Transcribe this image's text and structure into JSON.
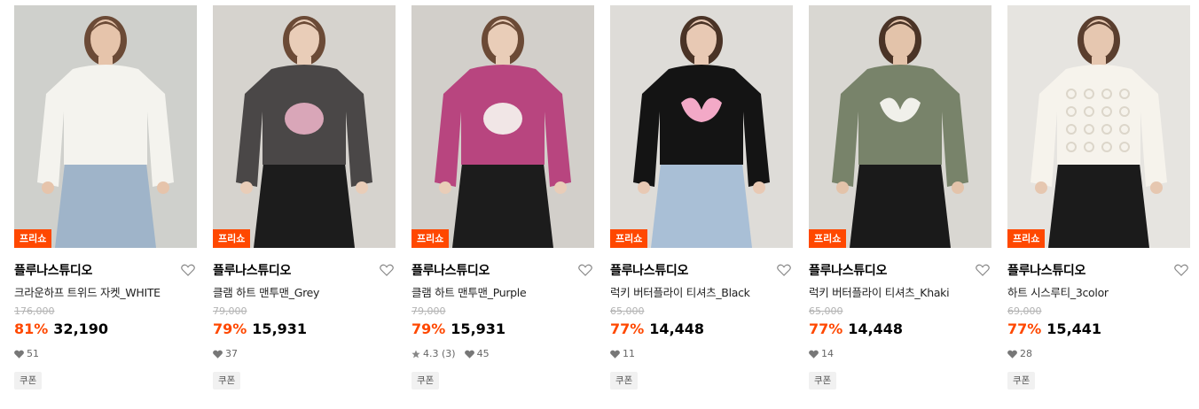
{
  "products": [
    {
      "tag": "프리쇼",
      "brand": "플루나스튜디오",
      "name": "크라운하프 트위드 자켓_WHITE",
      "original_price": "176,000",
      "discount": "81%",
      "price": "32,190",
      "rating": "",
      "likes": "51",
      "coupon": "쿠폰",
      "photo": {
        "bg": "#cfd0cc",
        "top": "#f4f3ee",
        "bottom": "#9fb4c9",
        "skin": "#e6c4ab",
        "hair": "#6b4a36",
        "accent": "#f4f3ee"
      }
    },
    {
      "tag": "프리쇼",
      "brand": "플루나스튜디오",
      "name": "클램 하트 맨투맨_Grey",
      "original_price": "79,000",
      "discount": "79%",
      "price": "15,931",
      "rating": "",
      "likes": "37",
      "coupon": "쿠폰",
      "photo": {
        "bg": "#d6d3ce",
        "top": "#4a4747",
        "bottom": "#1c1c1c",
        "skin": "#e9cdb8",
        "hair": "#6b4a36",
        "accent": "#d9a6b8"
      }
    },
    {
      "tag": "프리쇼",
      "brand": "플루나스튜디오",
      "name": "클램 하트 맨투맨_Purple",
      "original_price": "79,000",
      "discount": "79%",
      "price": "15,931",
      "rating": "4.3 (3)",
      "likes": "45",
      "coupon": "쿠폰",
      "photo": {
        "bg": "#d2cfca",
        "top": "#b8457f",
        "bottom": "#1c1c1c",
        "skin": "#e9cdb8",
        "hair": "#6b4a36",
        "accent": "#f1e6e6"
      }
    },
    {
      "tag": "프리쇼",
      "brand": "플루나스튜디오",
      "name": "럭키 버터플라이 티셔츠_Black",
      "original_price": "65,000",
      "discount": "77%",
      "price": "14,448",
      "rating": "",
      "likes": "11",
      "coupon": "쿠폰",
      "photo": {
        "bg": "#dedcd8",
        "top": "#141414",
        "bottom": "#a9bfd6",
        "skin": "#e8c9b4",
        "hair": "#4a3326",
        "accent": "#f3a9c7"
      }
    },
    {
      "tag": "프리쇼",
      "brand": "플루나스튜디오",
      "name": "럭키 버터플라이 티셔츠_Khaki",
      "original_price": "65,000",
      "discount": "77%",
      "price": "14,448",
      "rating": "",
      "likes": "14",
      "coupon": "쿠폰",
      "photo": {
        "bg": "#d9d7d2",
        "top": "#78836a",
        "bottom": "#1a1a1a",
        "skin": "#e3c3aa",
        "hair": "#4a3326",
        "accent": "#f0f0ea"
      }
    },
    {
      "tag": "프리쇼",
      "brand": "플루나스튜디오",
      "name": "하트 시스루티_3color",
      "original_price": "69,000",
      "discount": "77%",
      "price": "15,441",
      "rating": "",
      "likes": "28",
      "coupon": "쿠폰",
      "photo": {
        "bg": "#e6e4e0",
        "top": "#f6f3ec",
        "bottom": "#1b1b1b",
        "skin": "#e6c7b0",
        "hair": "#5a3e2e",
        "accent": "#dcd6ca"
      }
    }
  ],
  "colors": {
    "accent": "#ff4800",
    "muted": "#b3b3b3"
  }
}
